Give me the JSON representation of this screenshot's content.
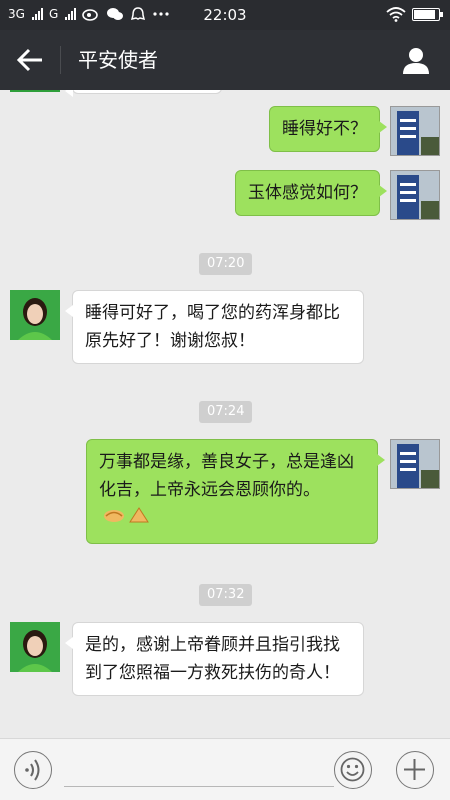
{
  "status_bar": {
    "network_1": "3G",
    "network_2": "G",
    "time": "22:03"
  },
  "header": {
    "title": "平安使者",
    "back_icon": "arrow-left-icon",
    "profile_icon": "person-icon"
  },
  "messages": [
    {
      "sender": "me",
      "text": "睡得好不？"
    },
    {
      "sender": "me",
      "text": "玉体感觉如何？"
    },
    {
      "sender": "them",
      "text": "睡得可好了，喝了您的药浑身都比原先好了！谢谢您叔！"
    },
    {
      "sender": "me",
      "text": "万事都是缘，善良女子，总是逢凶化吉，上帝永远会恩顾你的。"
    },
    {
      "sender": "them",
      "text": "是的，感谢上帝眷顾并且指引我找到了您照福一方救死扶伤的奇人！"
    }
  ],
  "timestamps": [
    "07:20",
    "07:24",
    "07:32"
  ],
  "input_bar": {
    "voice_icon": "voice-icon",
    "emoji_icon": "emoji-icon",
    "plus_icon": "plus-icon",
    "placeholder": ""
  },
  "colors": {
    "header_bg": "#2e3035",
    "my_bubble": "#9de15e",
    "their_bubble": "#ffffff",
    "chat_bg": "#ebebeb"
  }
}
